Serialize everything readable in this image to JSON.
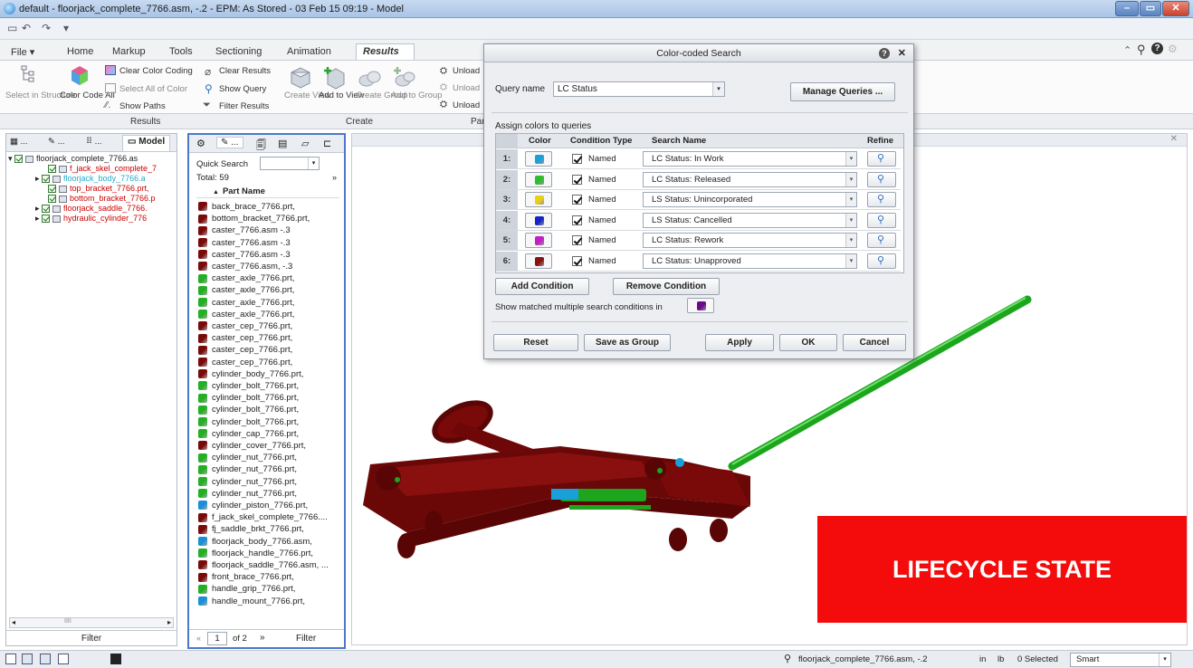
{
  "window": {
    "title": "default - floorjack_complete_7766.asm,        -.2 - EPM: As Stored - 03 Feb 15 09:19 - Model",
    "minimize": "–",
    "maximize": "▭",
    "close": "✕"
  },
  "qat": {
    "new": "▭",
    "undo": "↶",
    "redo": "↷",
    "more": "▾"
  },
  "tabs": [
    "File",
    "Home",
    "Markup",
    "Tools",
    "Sectioning",
    "Animation",
    "Results"
  ],
  "ribbon": {
    "select_in_structure": "Select in Structure",
    "color_code_all": "Color Code All",
    "clear_color_coding": "Clear Color Coding",
    "clear_results": "Clear Results",
    "select_all_of_color": "Select All of Color",
    "show_query": "Show Query",
    "show_paths": "Show Paths",
    "filter_results": "Filter Results",
    "create_view": "Create View",
    "add_to_view": "Add to View",
    "create_group": "Create Group",
    "add_to_group": "Add to Group",
    "unload_1": "Unload",
    "unload_2": "Unload",
    "unload_3": "Unload",
    "group_results": "Results",
    "group_create": "Create",
    "group_par": "Par"
  },
  "left_panel": {
    "tabs": [
      "...",
      "...",
      "...",
      "Model"
    ],
    "tree": [
      {
        "label": "floorjack_complete_7766.as",
        "color": "#222222",
        "level": 0
      },
      {
        "label": "f_jack_skel_complete_7",
        "color": "#cc0000",
        "level": 1
      },
      {
        "label": "floorjack_body_7766.a",
        "color": "#22aacc",
        "level": 1
      },
      {
        "label": "top_bracket_7766.prt,",
        "color": "#cc0000",
        "level": 1
      },
      {
        "label": "bottom_bracket_7766.p",
        "color": "#cc0000",
        "level": 1
      },
      {
        "label": "floorjack_saddle_7766.",
        "color": "#cc0000",
        "level": 1
      },
      {
        "label": "hydraulic_cylinder_776",
        "color": "#cc0000",
        "level": 1
      }
    ],
    "filter": "Filter",
    "hscroll": "IIII"
  },
  "mid_panel": {
    "quick_search_label": "Quick Search",
    "total": "Total: 59",
    "column_header": "Part Name",
    "page_current": "1",
    "page_of": "of 2",
    "filter": "Filter",
    "parts": [
      {
        "name": "back_brace_7766.prt,",
        "color": "#7a0a0a"
      },
      {
        "name": "bottom_bracket_7766.prt,",
        "color": "#7a0a0a"
      },
      {
        "name": "caster_7766.asm          -.3",
        "color": "#7a0a0a"
      },
      {
        "name": "caster_7766.asm          -.3",
        "color": "#7a0a0a"
      },
      {
        "name": "caster_7766.asm          -.3",
        "color": "#7a0a0a"
      },
      {
        "name": "caster_7766.asm,          -.3",
        "color": "#7a0a0a"
      },
      {
        "name": "caster_axle_7766.prt,",
        "color": "#22b022"
      },
      {
        "name": "caster_axle_7766.prt,",
        "color": "#22b022"
      },
      {
        "name": "caster_axle_7766.prt,",
        "color": "#22b022"
      },
      {
        "name": "caster_axle_7766.prt,",
        "color": "#22b022"
      },
      {
        "name": "caster_cep_7766.prt,",
        "color": "#7a0a0a"
      },
      {
        "name": "caster_cep_7766.prt,",
        "color": "#7a0a0a"
      },
      {
        "name": "caster_cep_7766.prt,",
        "color": "#7a0a0a"
      },
      {
        "name": "caster_cep_7766.prt,",
        "color": "#7a0a0a"
      },
      {
        "name": "cylinder_body_7766.prt,",
        "color": "#7a0a0a"
      },
      {
        "name": "cylinder_bolt_7766.prt,",
        "color": "#22b022"
      },
      {
        "name": "cylinder_bolt_7766.prt,",
        "color": "#22b022"
      },
      {
        "name": "cylinder_bolt_7766.prt,",
        "color": "#22b022"
      },
      {
        "name": "cylinder_bolt_7766.prt,",
        "color": "#22b022"
      },
      {
        "name": "cylinder_cap_7766.prt,",
        "color": "#22b022"
      },
      {
        "name": "cylinder_cover_7766.prt,",
        "color": "#7a0a0a"
      },
      {
        "name": "cylinder_nut_7766.prt,",
        "color": "#22b022"
      },
      {
        "name": "cylinder_nut_7766.prt,",
        "color": "#22b022"
      },
      {
        "name": "cylinder_nut_7766.prt,",
        "color": "#22b022"
      },
      {
        "name": "cylinder_nut_7766.prt,",
        "color": "#22b022"
      },
      {
        "name": "cylinder_piston_7766.prt,",
        "color": "#1a8fd6"
      },
      {
        "name": "f_jack_skel_complete_7766....",
        "color": "#7a0a0a"
      },
      {
        "name": "fj_saddle_brkt_7766.prt,",
        "color": "#7a0a0a"
      },
      {
        "name": "floorjack_body_7766.asm,",
        "color": "#1a8fd6"
      },
      {
        "name": "floorjack_handle_7766.prt,",
        "color": "#22b022"
      },
      {
        "name": "floorjack_saddle_7766.asm, ...",
        "color": "#7a0a0a"
      },
      {
        "name": "front_brace_7766.prt,",
        "color": "#7a0a0a"
      },
      {
        "name": "handle_grip_7766.prt,",
        "color": "#22b022"
      },
      {
        "name": "handle_mount_7766.prt,",
        "color": "#1a8fd6"
      }
    ]
  },
  "dialog": {
    "title": "Color-coded Search",
    "help": "?",
    "close": "✕",
    "query_name_label": "Query name",
    "query_name_value": "LC Status",
    "manage_queries": "Manage Queries ...",
    "assign_label": "Assign colors to queries",
    "headers": {
      "color": "Color",
      "condition_type": "Condition Type",
      "search_name": "Search Name",
      "refine": "Refine"
    },
    "rows": [
      {
        "num": "1:",
        "color": "#1aa0d8",
        "type": "Named",
        "search": "LC Status: In Work"
      },
      {
        "num": "2:",
        "color": "#2ebd2e",
        "type": "Named",
        "search": "LC Status: Released"
      },
      {
        "num": "3:",
        "color": "#e8cf1a",
        "type": "Named",
        "search": "LS Status: Unincorporated"
      },
      {
        "num": "4:",
        "color": "#1424c8",
        "type": "Named",
        "search": "LS Status: Cancelled"
      },
      {
        "num": "5:",
        "color": "#c21fc2",
        "type": "Named",
        "search": "LC Status: Rework"
      },
      {
        "num": "6:",
        "color": "#8a1010",
        "type": "Named",
        "search": "LC Status: Unapproved"
      }
    ],
    "add_condition": "Add Condition",
    "remove_condition": "Remove Condition",
    "show_matched": "Show matched multiple search conditions in",
    "multi_color": "#6a0a8a",
    "reset": "Reset",
    "save_as_group": "Save as Group",
    "apply": "Apply",
    "ok": "OK",
    "cancel": "Cancel"
  },
  "viewport": {
    "close": "✕",
    "banner": "LIFECYCLE STATE"
  },
  "statusbar": {
    "model": "floorjack_complete_7766.asm,          -.2",
    "units1": "in",
    "units2": "lb",
    "selected": "0 Selected",
    "filter": "Smart"
  }
}
